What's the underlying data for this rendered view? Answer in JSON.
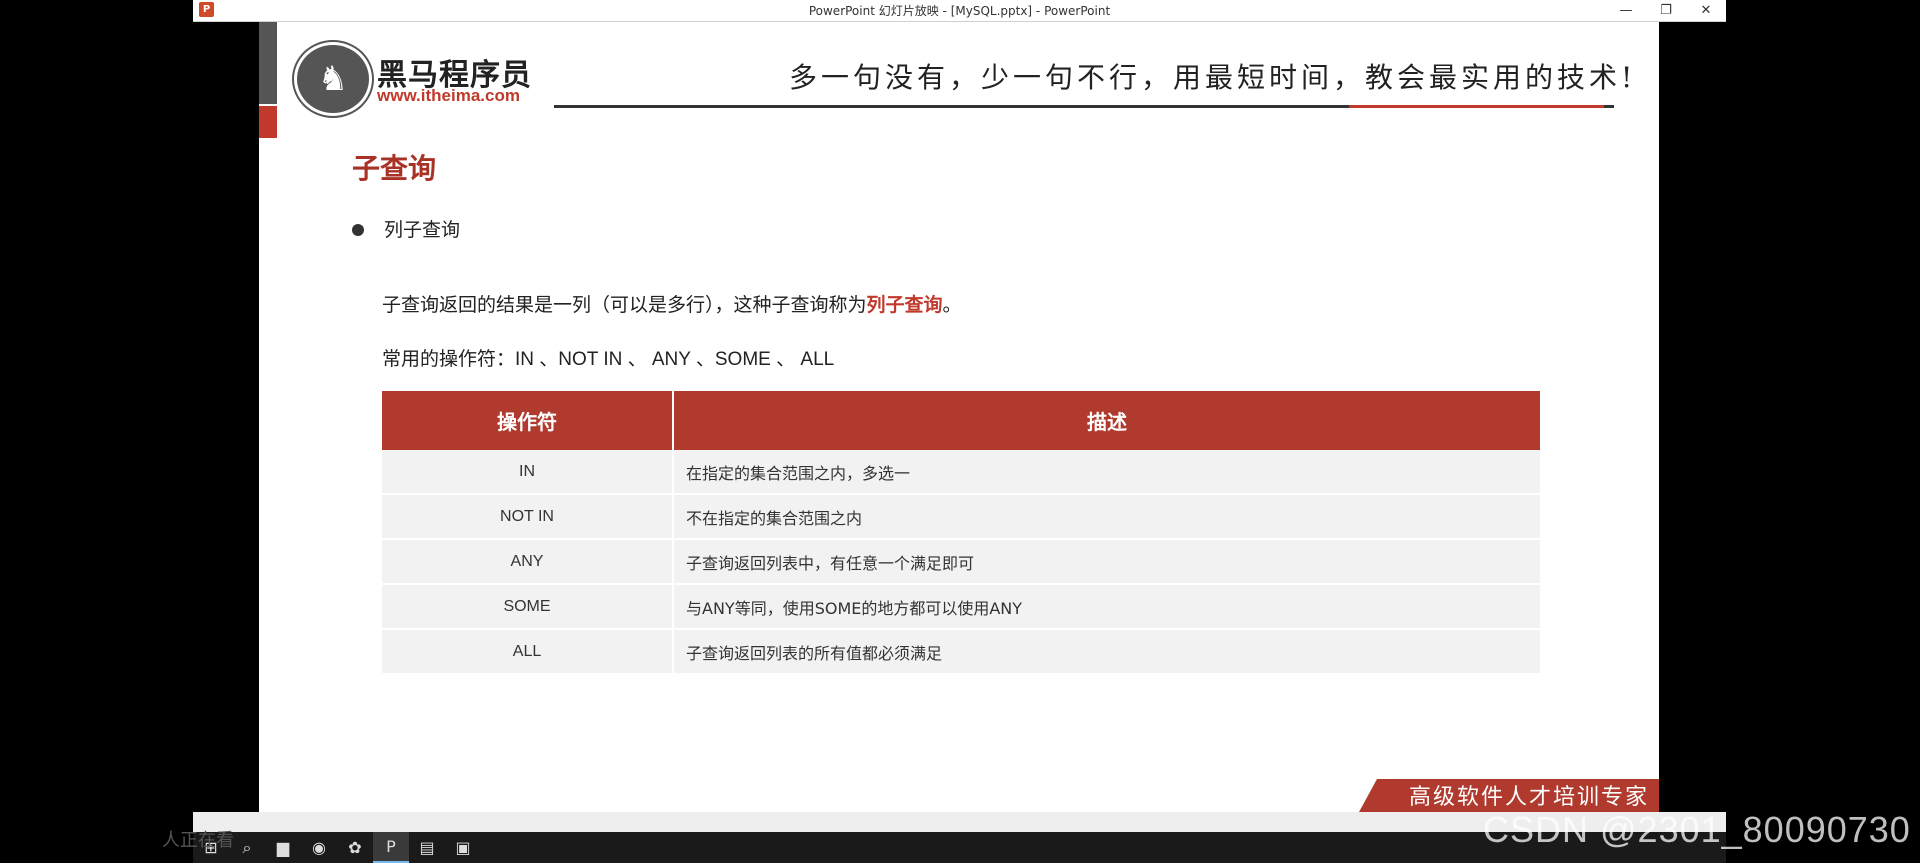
{
  "window": {
    "title": "PowerPoint 幻灯片放映 - [MySQL.pptx] - PowerPoint",
    "controls": [
      "—",
      "❐",
      "✕"
    ]
  },
  "slide": {
    "brand_name": "黑马程序员",
    "brand_url": "www.itheima.com",
    "slogan": "多一句没有，少一句不行，用最短时间，教会最实用的技术!",
    "heading": "子查询",
    "bullet": "列子查询",
    "para1_prefix": "子查询返回的结果是一列（可以是多行），这种子查询称为",
    "para1_highlight": "列子查询",
    "para1_suffix": "。",
    "para2": "常用的操作符：IN 、NOT IN 、 ANY 、SOME 、 ALL",
    "table": {
      "headers": [
        "操作符",
        "描述"
      ],
      "rows": [
        {
          "op": "IN",
          "desc": "在指定的集合范围之内，多选一"
        },
        {
          "op": "NOT IN",
          "desc": "不在指定的集合范围之内"
        },
        {
          "op": "ANY",
          "desc": "子查询返回列表中，有任意一个满足即可"
        },
        {
          "op": "SOME",
          "desc": "与ANY等同，使用SOME的地方都可以使用ANY"
        },
        {
          "op": "ALL",
          "desc": "子查询返回列表的所有值都必须满足"
        }
      ]
    },
    "footer_banner": "高级软件人才培训专家"
  },
  "overlay": {
    "viewer_count": "人正在看",
    "watermark": "CSDN @2301_80090730"
  },
  "colors": {
    "accent_red": "#b03a2e",
    "heading_red": "#a93226"
  }
}
